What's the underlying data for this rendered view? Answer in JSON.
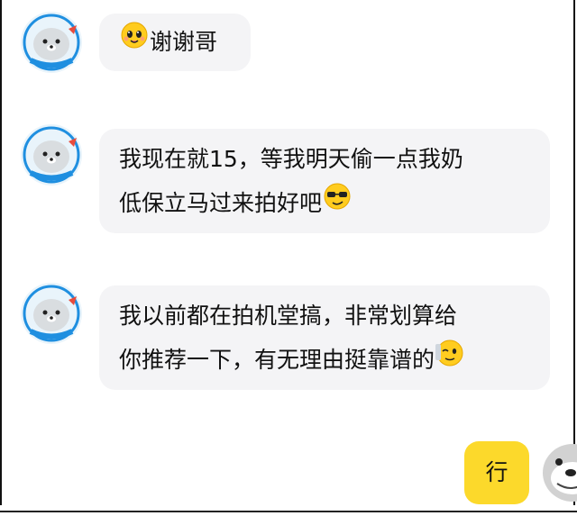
{
  "messages": [
    {
      "from": "other",
      "avatar": "seal-avatar-icon",
      "lines": [
        "谢谢哥"
      ],
      "emoji_start": "cute-yellow-face-icon"
    },
    {
      "from": "other",
      "avatar": "seal-avatar-icon",
      "lines": [
        "我现在就15，等我明天偷一点我奶",
        "低保立马过来拍好吧"
      ],
      "emoji_end": "sunglasses-face-icon"
    },
    {
      "from": "other",
      "avatar": "seal-avatar-icon",
      "lines": [
        "我以前都在拍机堂搞，非常划算给",
        "你推荐一下，有无理由挺靠谱的"
      ],
      "emoji_end": "wink-face-icon"
    },
    {
      "from": "me",
      "avatar": "gray-seal-avatar-icon",
      "lines": [
        "行"
      ]
    }
  ],
  "colors": {
    "background": "#ffffff",
    "other_bubble": "#f4f4f6",
    "my_bubble": "#fcd92b",
    "avatar_blue": "#1f8fe0",
    "avatar_red": "#e84c3d"
  }
}
